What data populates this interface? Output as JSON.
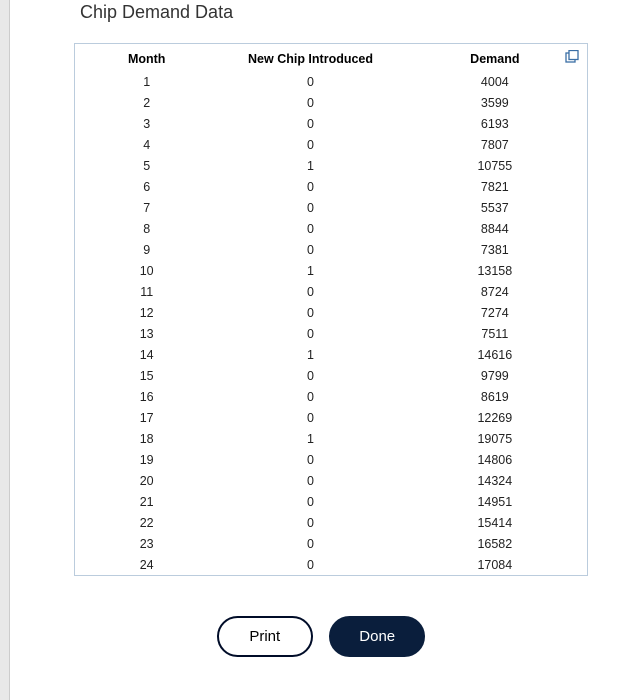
{
  "title": "Chip Demand Data",
  "columns": {
    "month": "Month",
    "new_chip": "New Chip Introduced",
    "demand": "Demand"
  },
  "rows": [
    {
      "month": "1",
      "new_chip": "0",
      "demand": "4004"
    },
    {
      "month": "2",
      "new_chip": "0",
      "demand": "3599"
    },
    {
      "month": "3",
      "new_chip": "0",
      "demand": "6193"
    },
    {
      "month": "4",
      "new_chip": "0",
      "demand": "7807"
    },
    {
      "month": "5",
      "new_chip": "1",
      "demand": "10755"
    },
    {
      "month": "6",
      "new_chip": "0",
      "demand": "7821"
    },
    {
      "month": "7",
      "new_chip": "0",
      "demand": "5537"
    },
    {
      "month": "8",
      "new_chip": "0",
      "demand": "8844"
    },
    {
      "month": "9",
      "new_chip": "0",
      "demand": "7381"
    },
    {
      "month": "10",
      "new_chip": "1",
      "demand": "13158"
    },
    {
      "month": "11",
      "new_chip": "0",
      "demand": "8724"
    },
    {
      "month": "12",
      "new_chip": "0",
      "demand": "7274"
    },
    {
      "month": "13",
      "new_chip": "0",
      "demand": "7511"
    },
    {
      "month": "14",
      "new_chip": "1",
      "demand": "14616"
    },
    {
      "month": "15",
      "new_chip": "0",
      "demand": "9799"
    },
    {
      "month": "16",
      "new_chip": "0",
      "demand": "8619"
    },
    {
      "month": "17",
      "new_chip": "0",
      "demand": "12269"
    },
    {
      "month": "18",
      "new_chip": "1",
      "demand": "19075"
    },
    {
      "month": "19",
      "new_chip": "0",
      "demand": "14806"
    },
    {
      "month": "20",
      "new_chip": "0",
      "demand": "14324"
    },
    {
      "month": "21",
      "new_chip": "0",
      "demand": "14951"
    },
    {
      "month": "22",
      "new_chip": "0",
      "demand": "15414"
    },
    {
      "month": "23",
      "new_chip": "0",
      "demand": "16582"
    },
    {
      "month": "24",
      "new_chip": "0",
      "demand": "17084"
    }
  ],
  "buttons": {
    "print": "Print",
    "done": "Done"
  },
  "icons": {
    "popout": "popout-icon"
  }
}
